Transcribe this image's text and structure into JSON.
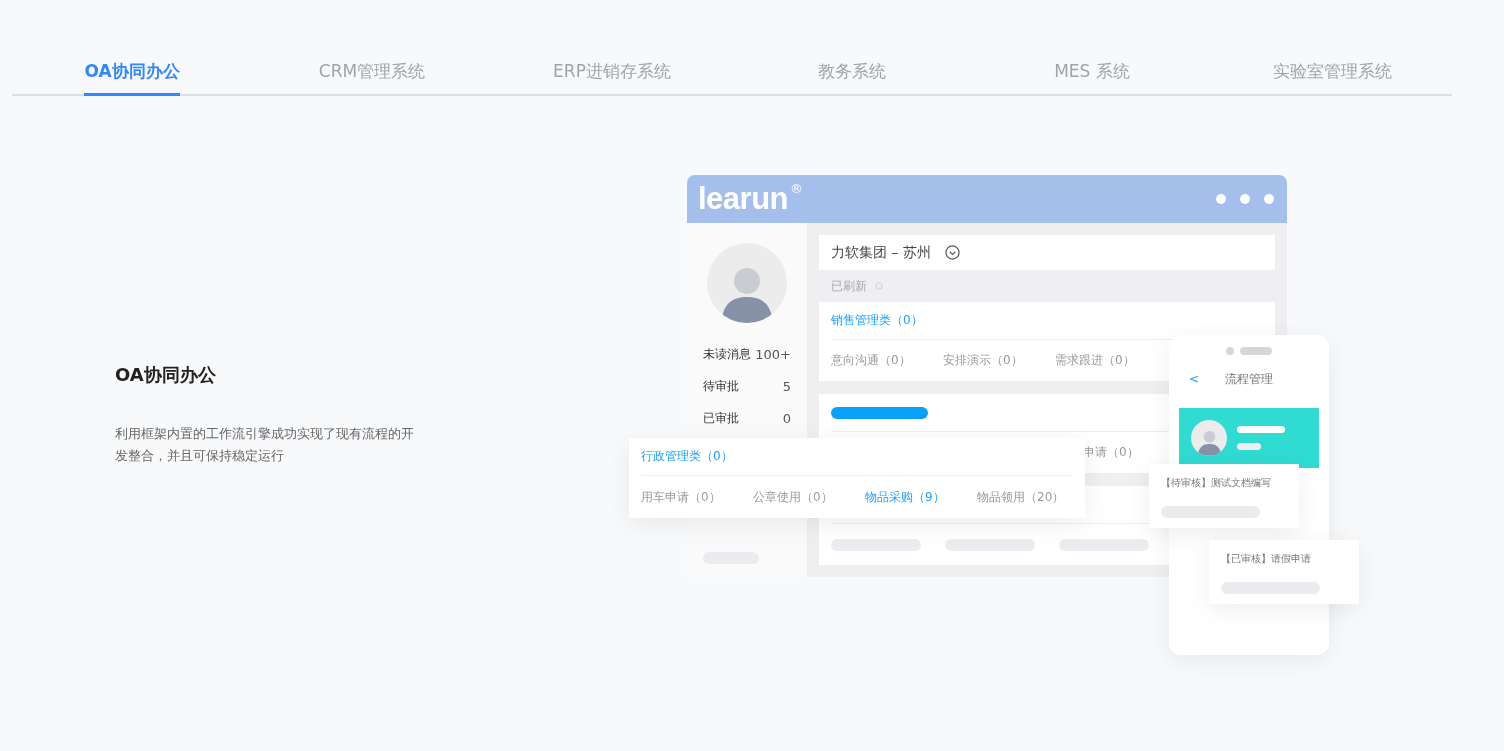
{
  "tabs": [
    {
      "label": "OA协同办公",
      "selected": true
    },
    {
      "label": "CRM管理系统",
      "selected": false
    },
    {
      "label": "ERP进销存系统",
      "selected": false
    },
    {
      "label": "教务系统",
      "selected": false
    },
    {
      "label": "MES 系统",
      "selected": false
    },
    {
      "label": "实验室管理系统",
      "selected": false
    }
  ],
  "intro": {
    "title": "OA协同办公",
    "description": "利用框架内置的工作流引擎成功实现了现有流程的开发整合，并且可保持稳定运行"
  },
  "mockup": {
    "brand": "learun",
    "brand_mark": "®",
    "org": "力软集团 – 苏州",
    "refresh": "已刷新",
    "stats": [
      {
        "label": "未读消息",
        "value": "100+"
      },
      {
        "label": "待审批",
        "value": "5"
      },
      {
        "label": "已审批",
        "value": "0"
      }
    ],
    "sales_card": {
      "title": "销售管理类（0）",
      "items": [
        "意向沟通（0）",
        "安排演示（0）",
        "需求跟进（0）"
      ]
    },
    "second_card": {
      "item": "申请（0）"
    },
    "admin_card": {
      "title": "行政管理类（0）",
      "items": [
        {
          "label": "用车申请（0）",
          "selected": false
        },
        {
          "label": "公章使用（0）",
          "selected": false
        },
        {
          "label": "物品采购（9）",
          "selected": true
        },
        {
          "label": "物品领用（20）",
          "selected": false
        }
      ]
    },
    "phone": {
      "back": "<",
      "title": "流程管理",
      "tasks": [
        "【待审核】测试文档编写",
        "【已审核】请假申请"
      ]
    }
  }
}
